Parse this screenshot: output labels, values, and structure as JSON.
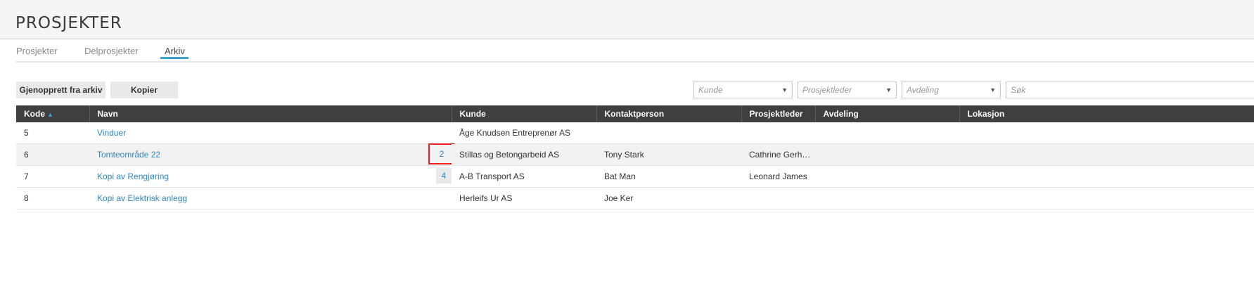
{
  "page": {
    "title": "PROSJEKTER"
  },
  "tabs": [
    {
      "label": "Prosjekter"
    },
    {
      "label": "Delprosjekter"
    },
    {
      "label": "Arkiv",
      "active": true
    }
  ],
  "toolbar": {
    "restore_label": "Gjenopprett fra arkiv",
    "copy_label": "Kopier"
  },
  "filters": {
    "kunde": {
      "placeholder": "Kunde"
    },
    "prosjektleder": {
      "placeholder": "Prosjektleder"
    },
    "avdeling": {
      "placeholder": "Avdeling"
    },
    "search": {
      "placeholder": "Søk"
    }
  },
  "table": {
    "columns": [
      "Kode",
      "Navn",
      "Kunde",
      "Kontaktperson",
      "Prosjektleder",
      "Avdeling",
      "Lokasjon"
    ],
    "sort_indicator": "▲",
    "rows": [
      {
        "kode": "5",
        "navn": "Vinduer",
        "count": "",
        "kunde": "Åge Knudsen Entreprenør AS",
        "kontaktperson": "",
        "prosjektleder": "",
        "avdeling": "",
        "lokasjon": ""
      },
      {
        "kode": "6",
        "navn": "Tomteområde 22",
        "count": "2",
        "kunde": "Stillas og Betongarbeid AS",
        "kontaktperson": "Tony Stark",
        "prosjektleder": "Cathrine Gerhardsen",
        "avdeling": "",
        "lokasjon": ""
      },
      {
        "kode": "7",
        "navn": "Kopi av Rengjøring",
        "count": "4",
        "kunde": "A-B Transport AS",
        "kontaktperson": "Bat Man",
        "prosjektleder": "Leonard James",
        "avdeling": "",
        "lokasjon": ""
      },
      {
        "kode": "8",
        "navn": "Kopi av Elektrisk anlegg",
        "count": "",
        "kunde": "Herleifs Ur AS",
        "kontaktperson": "Joe Ker",
        "prosjektleder": "",
        "avdeling": "",
        "lokasjon": ""
      }
    ]
  },
  "colors": {
    "accent": "#3aa3d4",
    "link": "#2f86c4",
    "header_bg": "#3f3f3f",
    "highlight": "#e22222"
  }
}
